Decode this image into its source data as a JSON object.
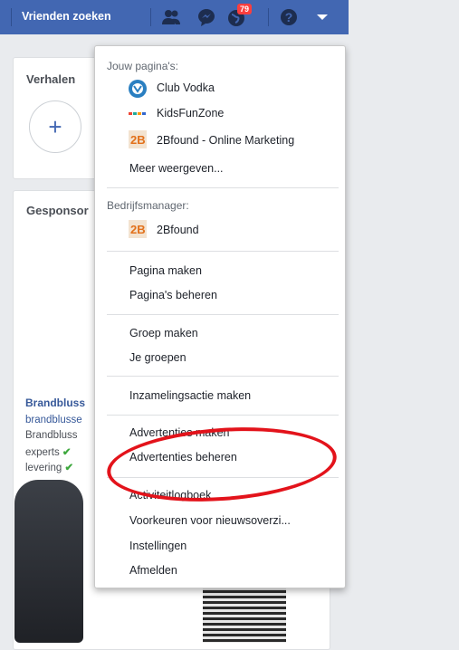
{
  "topbar": {
    "find_friends_label": "Vrienden zoeken",
    "notification_count": "79"
  },
  "feed": {
    "stories_title": "Verhalen",
    "sponsored_title": "Gesponsor",
    "ad_title": "Brandbluss",
    "ad_sub": "brandblusse",
    "ad_lines": [
      "Brandbluss",
      "experts",
      "levering"
    ]
  },
  "menu": {
    "your_pages_header": "Jouw pagina's:",
    "pages": [
      {
        "label": "Club Vodka"
      },
      {
        "label": "KidsFunZone"
      },
      {
        "label": "2Bfound - Online Marketing"
      }
    ],
    "show_more": "Meer weergeven...",
    "business_header": "Bedrijfsmanager:",
    "business_pages": [
      {
        "label": "2Bfound"
      }
    ],
    "create_page": "Pagina maken",
    "manage_pages": "Pagina's beheren",
    "create_group": "Groep maken",
    "your_groups": "Je groepen",
    "fundraiser": "Inzamelingsactie maken",
    "create_ads": "Advertenties maken",
    "manage_ads": "Advertenties beheren",
    "activity_log": "Activiteitlogboek",
    "news_feed_prefs": "Voorkeuren voor nieuwsoverzi...",
    "settings": "Instellingen",
    "logout": "Afmelden"
  },
  "colors": {
    "topbar": "#4267b2",
    "highlight": "#e3131b"
  }
}
